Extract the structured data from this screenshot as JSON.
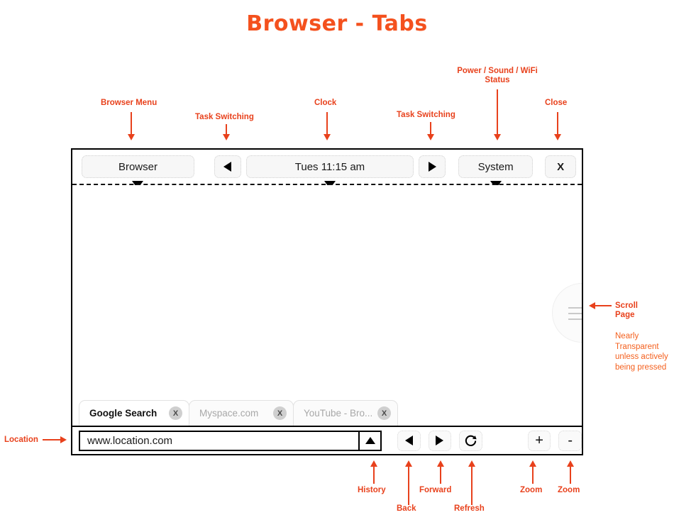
{
  "title": "Browser - Tabs",
  "colors": {
    "accent": "#e8411c",
    "title": "#f4511e",
    "note": "#f4601e",
    "frame": "#000000"
  },
  "annotations": {
    "browser_menu": "Browser Menu",
    "task_switching_left": "Task Switching",
    "clock": "Clock",
    "task_switching_right": "Task Switching",
    "power_status_line1": "Power / Sound / WiFi",
    "power_status_line2": "Status",
    "close": "Close",
    "scroll_page_line1": "Scroll",
    "scroll_page_line2": "Page",
    "transparency_note": "Nearly Transparent unless actively being pressed",
    "location": "Location",
    "history": "History",
    "back": "Back",
    "forward": "Forward",
    "refresh": "Refresh",
    "zoom_in": "Zoom",
    "zoom_out": "Zoom"
  },
  "system_bar": {
    "browser_menu_label": "Browser",
    "task_prev_icon": "triangle-left-icon",
    "clock_label": "Tues 11:15 am",
    "task_next_icon": "triangle-right-icon",
    "system_label": "System",
    "close_label": "X"
  },
  "viewport": {
    "scroll_button_icon": "hamburger-icon"
  },
  "tabs": [
    {
      "label": "Google Search",
      "active": true,
      "close_label": "X"
    },
    {
      "label": "Myspace.com",
      "active": false,
      "close_label": "X"
    },
    {
      "label": "YouTube - Bro...",
      "active": false,
      "close_label": "X"
    }
  ],
  "bottom_toolbar": {
    "location_value": "www.location.com",
    "location_placeholder": "www.location.com",
    "history_icon": "triangle-up-icon",
    "back_icon": "triangle-left-icon",
    "forward_icon": "triangle-right-icon",
    "refresh_icon": "refresh-icon",
    "zoom_in_label": "+",
    "zoom_out_label": "-"
  }
}
